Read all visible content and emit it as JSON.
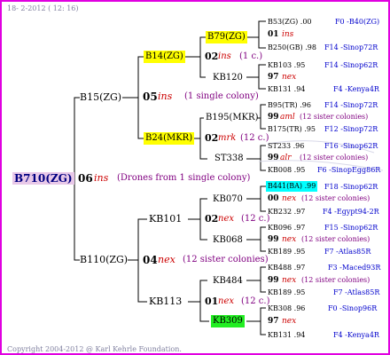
{
  "header": {
    "date": "18-  2-2012 ( 12: 16)"
  },
  "footer": {
    "copyright": "Copyright 2004-2012 @ Karl Kehrle Foundation."
  },
  "root": {
    "id": "B710(ZG)",
    "gen": "06",
    "ins": "ins",
    "note": "(Drones from 1 single colony)"
  },
  "gen1": [
    {
      "id": "B15(ZG)",
      "gen": "05",
      "ins": "ins",
      "note": "(1 single colony)"
    },
    {
      "id": "B110(ZG)",
      "gen": "04",
      "ins": "nex",
      "note": "(12 sister colonies)"
    }
  ],
  "gen2": [
    {
      "id": "B14(ZG)"
    },
    {
      "id": "B24(MKR)"
    },
    {
      "id": "KB101",
      "gen": "02",
      "ins": "nex",
      "note": "(12 c.)"
    },
    {
      "id": "KB113",
      "gen": "01",
      "ins": "nex",
      "note": "(12 c.)"
    }
  ],
  "gen2_extra": [
    {
      "gen": "02",
      "ins": "ins",
      "note": "(1 c.)"
    },
    {
      "gen": "02",
      "ins": "mrk",
      "note": "(12 c.)"
    }
  ],
  "gen3": [
    {
      "id": "B79(ZG)"
    },
    {
      "id": "KB120"
    },
    {
      "id": "B195(MKR)"
    },
    {
      "id": "ST338"
    },
    {
      "id": "KB070"
    },
    {
      "id": "KB068"
    },
    {
      "id": "KB484"
    },
    {
      "id": "KB309"
    }
  ],
  "gen4": [
    {
      "sire": "B53(ZG) .00",
      "g": "01",
      "ins": "ins",
      "n": "",
      "dam": "B250(GB) .98",
      "mother": "KB131 .94",
      "r1": "F0 -B40(ZG)",
      "r2": "F14 -Sinop72R",
      "r3": "F14 -Sinop62R",
      "r4": "F4 -Kenya4R"
    },
    {
      "sire": "KB103 .95",
      "g": "97",
      "ins": "nex",
      "n": "",
      "dam": "",
      "mother": "",
      "r1": "",
      "r2": "",
      "r3": "",
      "r4": ""
    },
    {
      "sire": "B95(TR) .96",
      "g": "99",
      "ins": "aml",
      "n": "(12 sister colonies)",
      "dam": "B175(TR) .95",
      "mother": "",
      "r1": "F14 -Sinop72R",
      "r2": "F12 -Sinop72R",
      "r3": "",
      "r4": ""
    },
    {
      "sire": "ST233 .96",
      "g": "99",
      "ins": "alr",
      "n": "(12 sister colonies)",
      "dam": "KB008 .95",
      "mother": "",
      "r1": "F16 -Sinop62R",
      "r2": "F6 -SinopEgg86R",
      "r3": "",
      "r4": ""
    },
    {
      "sire": "B441(BA) .99",
      "g": "00",
      "ins": "nex",
      "n": "(12 sister colonies)",
      "dam": "KB232 .97",
      "mother": "",
      "r1": "F18 -Sinop62R",
      "r2": "F4 -Egypt94-2R",
      "r3": "",
      "r4": ""
    },
    {
      "sire": "KB096 .97",
      "g": "99",
      "ins": "nex",
      "n": "(12 sister colonies)",
      "dam": "KB189 .95",
      "mother": "",
      "r1": "F15 -Sinop62R",
      "r2": "F7 -Atlas85R",
      "r3": "",
      "r4": ""
    },
    {
      "sire": "KB488 .97",
      "g": "99",
      "ins": "nex",
      "n": "(12 sister colonies)",
      "dam": "KB189 .95",
      "mother": "",
      "r1": "F3 -Maced93R",
      "r2": "F7 -Atlas85R",
      "r3": "",
      "r4": ""
    },
    {
      "sire": "KB308 .96",
      "g": "97",
      "ins": "nex",
      "n": "",
      "dam": "KB131 .94",
      "mother": "",
      "r1": "F0 -Sinop96R",
      "r2": "F4 -Kenya4R",
      "r3": "",
      "r4": ""
    }
  ]
}
